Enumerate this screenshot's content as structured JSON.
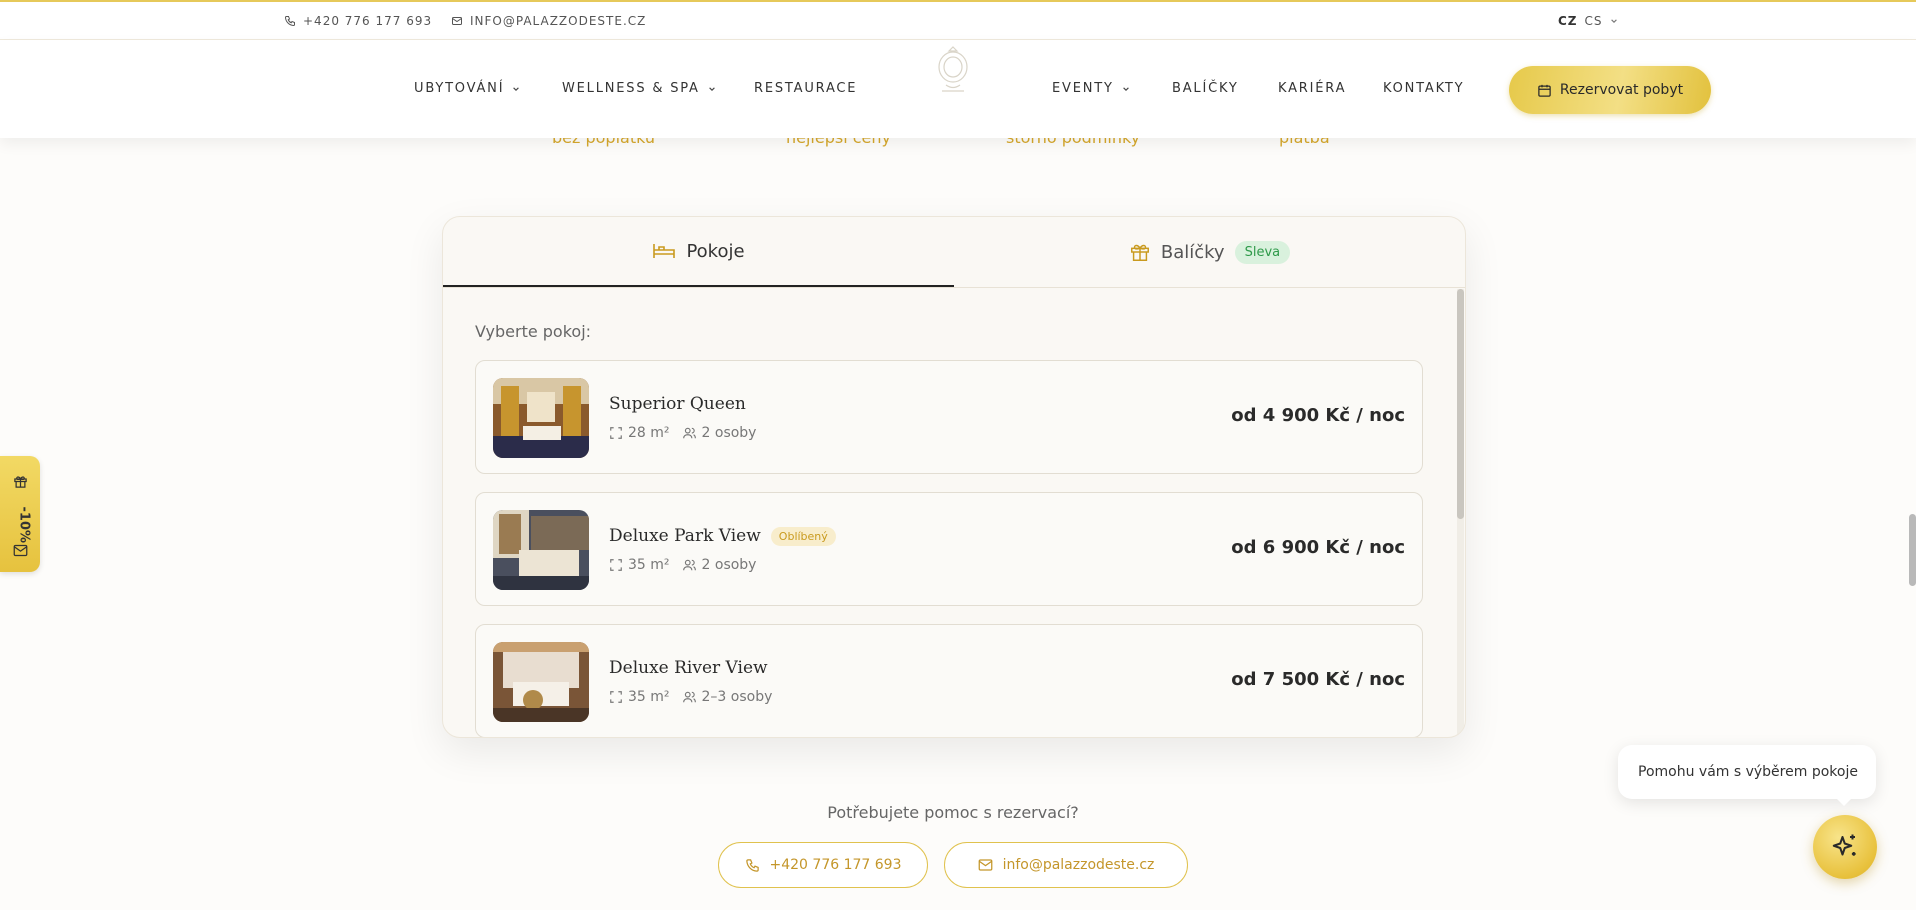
{
  "topbar": {
    "phone": "+420 776 177 693",
    "email": "INFO@PALAZZODESTE.CZ",
    "lang_code": "CZ",
    "lang_label": "CS"
  },
  "nav": {
    "items": [
      "UBYTOVÁNÍ",
      "WELLNESS & SPA",
      "RESTAURACE",
      "EVENTY",
      "BALÍČKY",
      "KARIÉRA",
      "KONTAKTY"
    ],
    "book_button": "Rezervovat pobyt"
  },
  "benefits": [
    "bez poplatku",
    "nejlepší ceny",
    "storno podmínky",
    "platba"
  ],
  "booking": {
    "tabs": [
      {
        "label": "Pokoje",
        "active": true
      },
      {
        "label": "Balíčky",
        "badge": "Sleva",
        "active": false
      }
    ],
    "select_label": "Vyberte pokoj:",
    "rooms": [
      {
        "name": "Superior Queen",
        "size": "28 m²",
        "guests": "2 osoby",
        "price": "od 4 900 Kč / noc",
        "tag": ""
      },
      {
        "name": "Deluxe Park View",
        "size": "35 m²",
        "guests": "2 osoby",
        "price": "od 6 900 Kč / noc",
        "tag": "Oblíbený"
      },
      {
        "name": "Deluxe River View",
        "size": "35 m²",
        "guests": "2–3 osoby",
        "price": "od 7 500 Kč / noc",
        "tag": ""
      }
    ]
  },
  "help": {
    "question": "Potřebujete pomoc s rezervací?",
    "phone": "+420 776 177 693",
    "email": "info@palazzodeste.cz"
  },
  "promo": {
    "label": "-10%"
  },
  "chat": {
    "bubble": "Pomohu vám s výběrem pokoje"
  },
  "colors": {
    "accent": "#e6c94a",
    "accent_text": "#c4962a",
    "success": "#2f9a4a"
  }
}
